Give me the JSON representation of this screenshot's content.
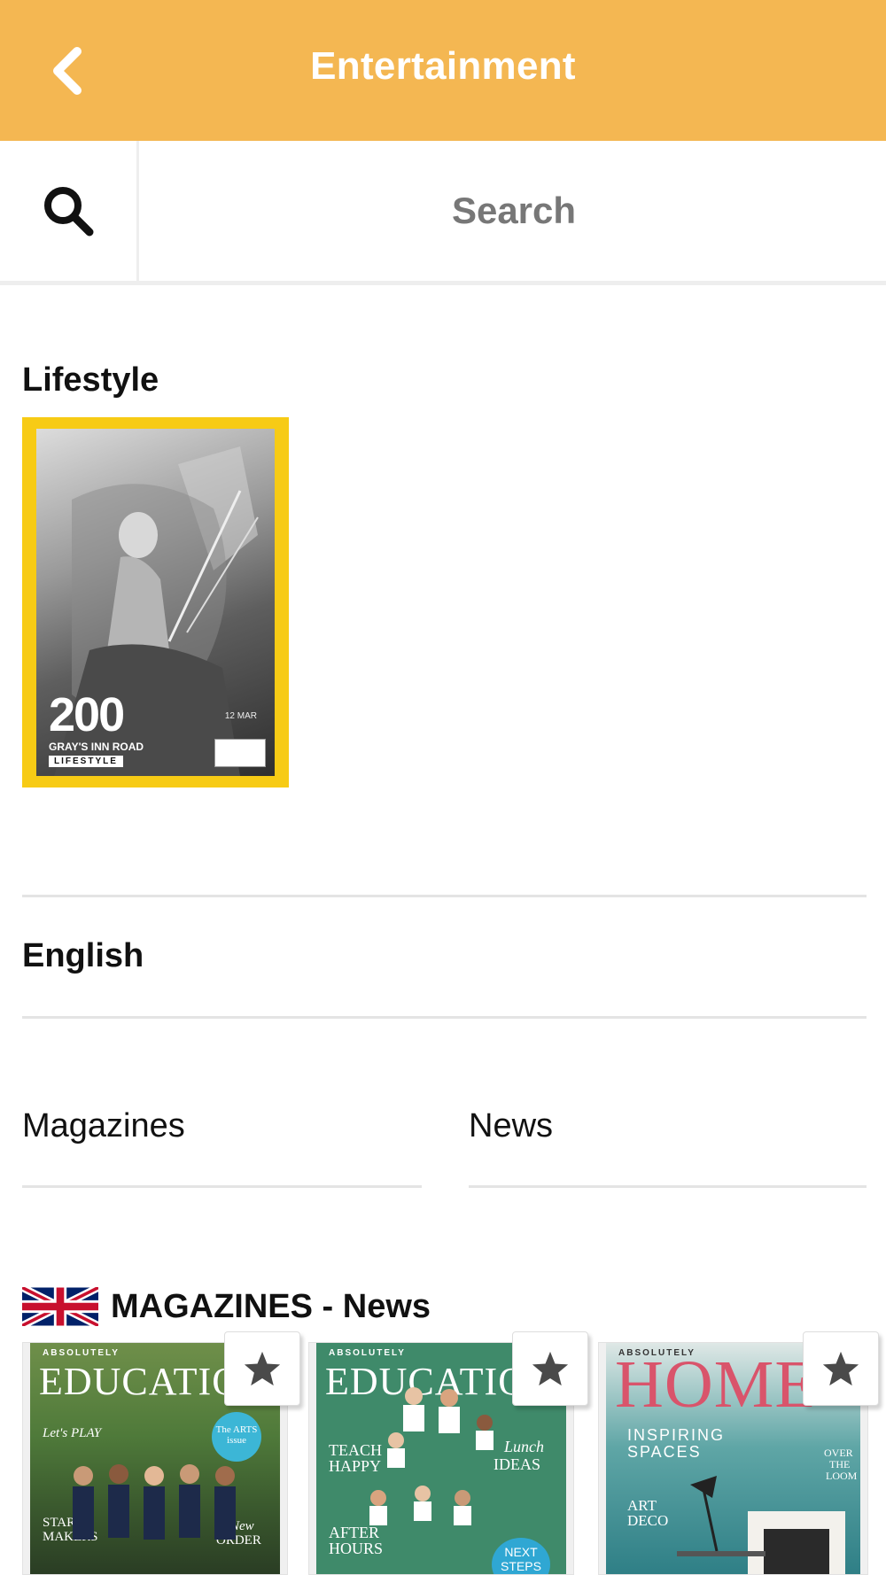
{
  "header": {
    "title": "Entertainment",
    "back_icon": "chevron-left-icon",
    "background": "#f4b752"
  },
  "search": {
    "placeholder": "Search",
    "icon": "search-icon"
  },
  "lifestyle": {
    "section_title": "Lifestyle",
    "card": {
      "big_text": "200",
      "sub_text": "GRAY'S INN ROAD",
      "tag": "LIFESTYLE",
      "date": "12 MAR",
      "frame_color": "#f7cb15"
    }
  },
  "language": {
    "label": "English"
  },
  "filters": {
    "left": "Magazines",
    "right": "News"
  },
  "magazines_section": {
    "flag_icon": "uk-flag-icon",
    "title": "MAGAZINES - News",
    "items": [
      {
        "brand": "ABSOLUTELY",
        "title": "EDUCATIO",
        "lines": [
          "Let's PLAY",
          "STAR",
          "MAKERS",
          "New",
          "ORDER"
        ],
        "badge": "The ARTS issue",
        "star_icon": "star-icon"
      },
      {
        "brand": "ABSOLUTELY",
        "title": "EDUCATIO",
        "lines": [
          "TEACH",
          "HAPPY",
          "Lunch",
          "IDEAS",
          "AFTER",
          "HOURS"
        ],
        "badge": "NEXT STEPS",
        "star_icon": "star-icon"
      },
      {
        "brand": "ABSOLUTELY",
        "title": "HOME",
        "lines": [
          "INSPIRING",
          "SPACES",
          "ART",
          "DECO",
          "OVER",
          "THE",
          "LOOM"
        ],
        "star_icon": "star-icon"
      }
    ]
  }
}
